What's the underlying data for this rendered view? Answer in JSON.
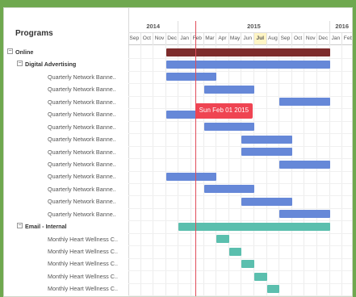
{
  "panel_title": "Programs",
  "years": [
    "2014",
    "2015",
    "2016"
  ],
  "months": [
    "Sep",
    "Oct",
    "Nov",
    "Dec",
    "Jan",
    "Feb",
    "Mar",
    "Apr",
    "May",
    "Jun",
    "Jul",
    "Aug",
    "Sep",
    "Oct",
    "Nov",
    "Dec",
    "Jan",
    "Feb"
  ],
  "highlight_month_index": 10,
  "tooltip_text": "Sun Feb 01 2015",
  "today_month_pos": 5.3,
  "rows": [
    {
      "label": "Online",
      "level": 0,
      "expander": "−",
      "bar": {
        "start": 3,
        "end": 16,
        "color": "#7d2c2c"
      }
    },
    {
      "label": "Digital Advertising",
      "level": 1,
      "expander": "−",
      "bar": {
        "start": 3,
        "end": 16,
        "color": "#6688d8"
      }
    },
    {
      "label": "Quarterly Network Banne..",
      "level": 2,
      "bar": {
        "start": 3,
        "end": 7,
        "color": "#6688d8"
      }
    },
    {
      "label": "Quarterly Network Banne..",
      "level": 2,
      "bar": {
        "start": 6,
        "end": 10,
        "color": "#6688d8"
      }
    },
    {
      "label": "Quarterly Network Banne..",
      "level": 2,
      "bar": {
        "start": 12,
        "end": 16,
        "color": "#6688d8"
      }
    },
    {
      "label": "Quarterly Network Banne..",
      "level": 2,
      "bar": {
        "start": 3,
        "end": 7,
        "color": "#6688d8"
      }
    },
    {
      "label": "Quarterly Network Banne..",
      "level": 2,
      "bar": {
        "start": 6,
        "end": 10,
        "color": "#6688d8"
      }
    },
    {
      "label": "Quarterly Network Banne..",
      "level": 2,
      "bar": {
        "start": 9,
        "end": 13,
        "color": "#6688d8"
      }
    },
    {
      "label": "Quarterly Network Banne..",
      "level": 2,
      "bar": {
        "start": 9,
        "end": 13,
        "color": "#6688d8"
      }
    },
    {
      "label": "Quarterly Network Banne..",
      "level": 2,
      "bar": {
        "start": 12,
        "end": 16,
        "color": "#6688d8"
      }
    },
    {
      "label": "Quarterly Network Banne..",
      "level": 2,
      "bar": {
        "start": 3,
        "end": 7,
        "color": "#6688d8"
      }
    },
    {
      "label": "Quarterly Network Banne..",
      "level": 2,
      "bar": {
        "start": 6,
        "end": 10,
        "color": "#6688d8"
      }
    },
    {
      "label": "Quarterly Network Banne..",
      "level": 2,
      "bar": {
        "start": 9,
        "end": 13,
        "color": "#6688d8"
      }
    },
    {
      "label": "Quarterly Network Banne..",
      "level": 2,
      "bar": {
        "start": 12,
        "end": 16,
        "color": "#6688d8"
      }
    },
    {
      "label": "Email - Internal",
      "level": 1,
      "expander": "−",
      "bar": {
        "start": 4,
        "end": 16,
        "color": "#5bbfae"
      }
    },
    {
      "label": "Monthly Heart Wellness C..",
      "level": 2,
      "bar": {
        "start": 7,
        "end": 8,
        "color": "#5bbfae"
      }
    },
    {
      "label": "Monthly Heart Wellness C..",
      "level": 2,
      "bar": {
        "start": 8,
        "end": 9,
        "color": "#5bbfae"
      }
    },
    {
      "label": "Monthly Heart Wellness C..",
      "level": 2,
      "bar": {
        "start": 9,
        "end": 10,
        "color": "#5bbfae"
      }
    },
    {
      "label": "Monthly Heart Wellness C..",
      "level": 2,
      "bar": {
        "start": 10,
        "end": 11,
        "color": "#5bbfae"
      }
    },
    {
      "label": "Monthly Heart Wellness C..",
      "level": 2,
      "bar": {
        "start": 11,
        "end": 12,
        "color": "#5bbfae"
      }
    }
  ]
}
